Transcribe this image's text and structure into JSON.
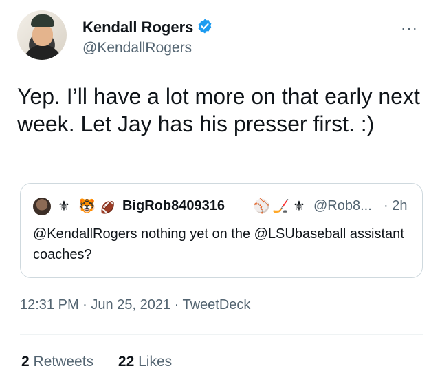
{
  "author": {
    "name": "Kendall Rogers",
    "handle": "@KendallRogers",
    "verified": true,
    "avatar_icon": "profile-photo"
  },
  "tweet": {
    "text": "Yep. I’ll have a lot more on that early next week. Let Jay has his presser first. :)",
    "time": "12:31 PM",
    "date": "Jun 25, 2021",
    "source": "TweetDeck",
    "separator": "·"
  },
  "quoted": {
    "emoji": [
      "⚜",
      "🐯",
      "🏈"
    ],
    "name": "BigRob8409316",
    "name_emoji": [
      "⚾",
      "🏒",
      "⚜"
    ],
    "handle": "@Rob8...",
    "age": "· 2h",
    "text": "@KendallRogers nothing yet on the @LSUbaseball assistant coaches?"
  },
  "stats": {
    "retweets_count": "2",
    "retweets_label": "Retweets",
    "likes_count": "22",
    "likes_label": "Likes"
  },
  "more_label": "···",
  "colors": {
    "text": "#0f1419",
    "secondary": "#536471",
    "verified": "#1d9bf0",
    "border": "#cfd9de"
  }
}
